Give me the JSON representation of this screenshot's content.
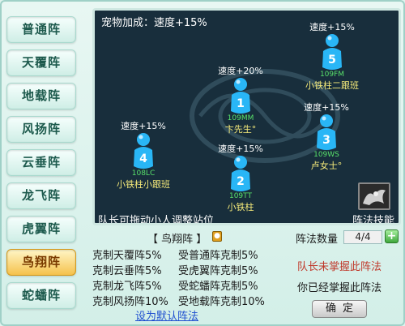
{
  "sidebar": {
    "items": [
      {
        "label": "普通阵"
      },
      {
        "label": "天覆阵"
      },
      {
        "label": "地载阵"
      },
      {
        "label": "风扬阵"
      },
      {
        "label": "云垂阵"
      },
      {
        "label": "龙飞阵"
      },
      {
        "label": "虎翼阵"
      },
      {
        "label": "鸟翔阵",
        "active": true
      },
      {
        "label": "蛇蟠阵"
      }
    ]
  },
  "board": {
    "pet_bonus": "宠物加成：速度+15%",
    "drag_hint": "队长可拖动小人调整站位",
    "skill_label": "阵法技能",
    "slots": [
      {
        "number": "1",
        "bonus": "速度+20%",
        "level": "109MM",
        "name": "卞先生°"
      },
      {
        "number": "2",
        "bonus": "速度+15%",
        "level": "109TT",
        "name": "小铁柱"
      },
      {
        "number": "3",
        "bonus": "速度+15%",
        "level": "109WS",
        "name": "卢女士°"
      },
      {
        "number": "4",
        "bonus": "速度+15%",
        "level": "108LC",
        "name": "小铁柱小跟班"
      },
      {
        "number": "5",
        "bonus": "速度+15%",
        "level": "109FM",
        "name": "小铁柱二跟班"
      }
    ]
  },
  "formation": {
    "title": "【 鸟翔阵 】",
    "relations": [
      [
        "克制天覆阵5%",
        "受普通阵克制5%"
      ],
      [
        "克制云垂阵5%",
        "受虎翼阵克制5%"
      ],
      [
        "克制龙飞阵5%",
        "受蛇蟠阵克制5%"
      ],
      [
        "克制风扬阵10%",
        "受地载阵克制10%"
      ]
    ],
    "set_default": "设为默认阵法"
  },
  "panel": {
    "count_label": "阵法数量",
    "count_value": "4/4",
    "plus": "+",
    "leader_msg": "队长未掌握此阵法",
    "self_msg": "你已经掌握此阵法",
    "confirm": "确定"
  },
  "colors": {
    "figure": "#29b6f6",
    "active_tab": "#f5c24c",
    "link": "#1f4fcf",
    "warning": "#c0392b"
  }
}
